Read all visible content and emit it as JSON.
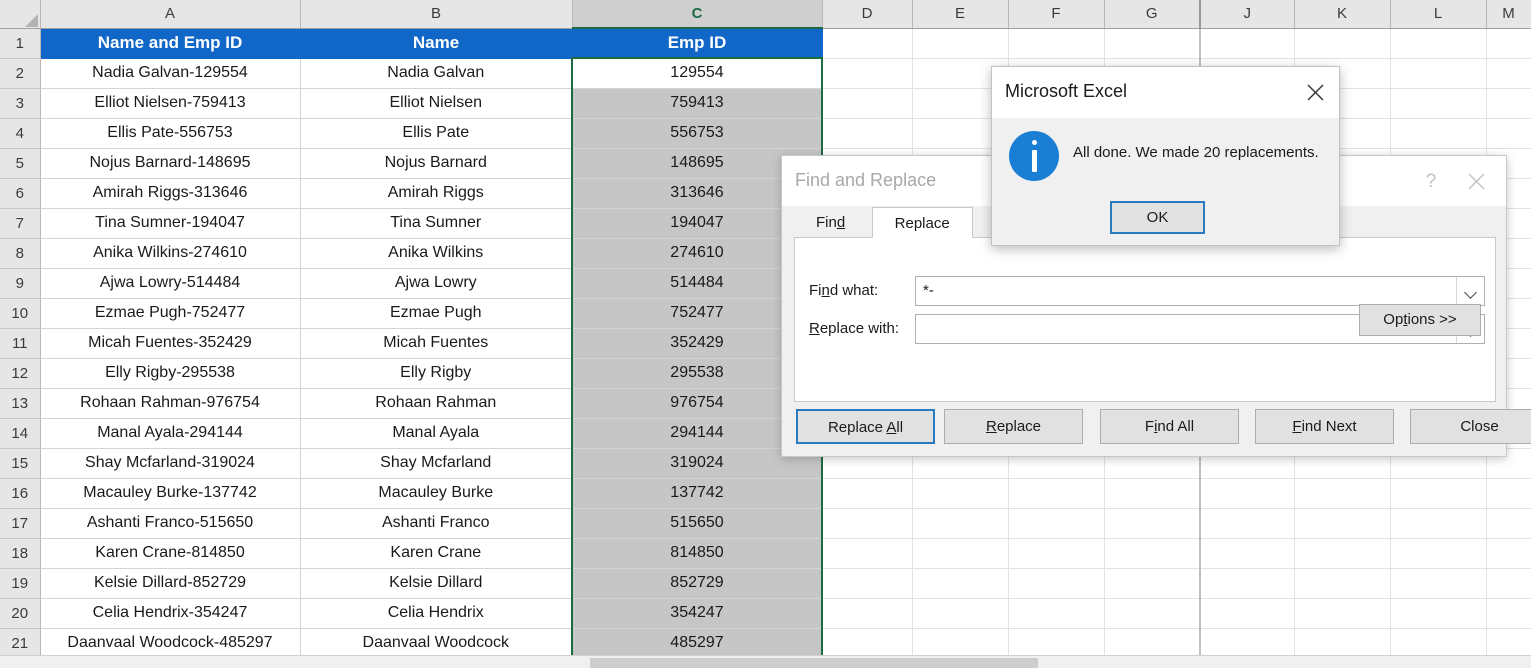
{
  "app": {
    "name": "Microsoft Excel"
  },
  "sheet": {
    "column_headers": [
      "A",
      "B",
      "C",
      "D",
      "E",
      "F",
      "G",
      "J",
      "K",
      "L",
      "M"
    ],
    "selected_column": "C",
    "hidden_after": "G",
    "row_headers": [
      "1",
      "2",
      "3",
      "4",
      "5",
      "6",
      "7",
      "8",
      "9",
      "10",
      "11",
      "12",
      "13",
      "14",
      "15",
      "16",
      "17",
      "18",
      "19",
      "20",
      "21"
    ],
    "header_row": {
      "a": "Name and Emp ID",
      "b": "Name",
      "c": "Emp ID"
    },
    "header_fill": "#1167c8",
    "header_text_color": "#ffffff",
    "selection_color": "#1d6b45",
    "selection_fill": "#c6c6c6",
    "active_cell": "C2",
    "rows": [
      {
        "row": "2",
        "a": "Nadia Galvan-129554",
        "b": "Nadia Galvan",
        "c": "129554"
      },
      {
        "row": "3",
        "a": "Elliot Nielsen-759413",
        "b": "Elliot Nielsen",
        "c": "759413"
      },
      {
        "row": "4",
        "a": "Ellis Pate-556753",
        "b": "Ellis Pate",
        "c": "556753"
      },
      {
        "row": "5",
        "a": "Nojus Barnard-148695",
        "b": "Nojus Barnard",
        "c": "148695"
      },
      {
        "row": "6",
        "a": "Amirah Riggs-313646",
        "b": "Amirah Riggs",
        "c": "313646"
      },
      {
        "row": "7",
        "a": "Tina Sumner-194047",
        "b": "Tina Sumner",
        "c": "194047"
      },
      {
        "row": "8",
        "a": "Anika Wilkins-274610",
        "b": "Anika Wilkins",
        "c": "274610"
      },
      {
        "row": "9",
        "a": "Ajwa Lowry-514484",
        "b": "Ajwa Lowry",
        "c": "514484"
      },
      {
        "row": "10",
        "a": "Ezmae Pugh-752477",
        "b": "Ezmae Pugh",
        "c": "752477"
      },
      {
        "row": "11",
        "a": "Micah Fuentes-352429",
        "b": "Micah Fuentes",
        "c": "352429"
      },
      {
        "row": "12",
        "a": "Elly Rigby-295538",
        "b": "Elly Rigby",
        "c": "295538"
      },
      {
        "row": "13",
        "a": "Rohaan Rahman-976754",
        "b": "Rohaan Rahman",
        "c": "976754"
      },
      {
        "row": "14",
        "a": "Manal Ayala-294144",
        "b": "Manal Ayala",
        "c": "294144"
      },
      {
        "row": "15",
        "a": "Shay Mcfarland-319024",
        "b": "Shay Mcfarland",
        "c": "319024"
      },
      {
        "row": "16",
        "a": "Macauley Burke-137742",
        "b": "Macauley Burke",
        "c": "137742"
      },
      {
        "row": "17",
        "a": "Ashanti Franco-515650",
        "b": "Ashanti Franco",
        "c": "515650"
      },
      {
        "row": "18",
        "a": "Karen Crane-814850",
        "b": "Karen Crane",
        "c": "814850"
      },
      {
        "row": "19",
        "a": "Kelsie Dillard-852729",
        "b": "Kelsie Dillard",
        "c": "852729"
      },
      {
        "row": "20",
        "a": "Celia Hendrix-354247",
        "b": "Celia Hendrix",
        "c": "354247"
      },
      {
        "row": "21",
        "a": "Daanvaal Woodcock-485297",
        "b": "Daanvaal Woodcock",
        "c": "485297"
      }
    ]
  },
  "find_replace_dialog": {
    "title": "Find and Replace",
    "help_label": "?",
    "tabs": [
      {
        "label": "Find",
        "accel": "d",
        "active": false
      },
      {
        "label": "Replace",
        "accel": "",
        "active": true
      }
    ],
    "find_what_label": "Find what:",
    "find_what_value": "*-",
    "replace_with_label": "Replace with:",
    "replace_with_value": "",
    "options_button": "Options >>",
    "buttons": [
      {
        "label": "Replace All",
        "default": true
      },
      {
        "label": "Replace",
        "default": false
      },
      {
        "label": "Find All",
        "default": false
      },
      {
        "label": "Find Next",
        "default": false
      },
      {
        "label": "Close",
        "default": false
      }
    ]
  },
  "message_box": {
    "title": "Microsoft Excel",
    "icon": "info-icon",
    "message": "All done. We made 20 replacements.",
    "ok_label": "OK"
  }
}
